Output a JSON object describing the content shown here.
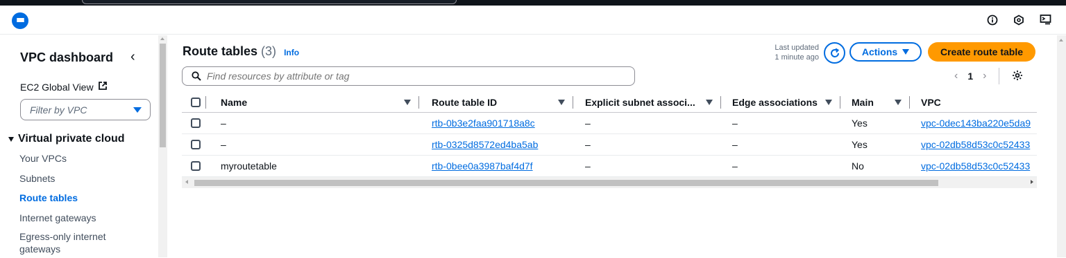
{
  "colors": {
    "accent": "#006ce0",
    "primary_button": "#ff9900",
    "top_strip": "#0f141a"
  },
  "header": {
    "icons": [
      "menu-icon",
      "info-icon",
      "notifications-icon",
      "cloudshell-icon"
    ]
  },
  "sidebar": {
    "title": "VPC dashboard",
    "ec2_global_view": "EC2 Global View",
    "filter_placeholder": "Filter by VPC",
    "section_title": "Virtual private cloud",
    "items": [
      {
        "label": "Your VPCs",
        "active": false
      },
      {
        "label": "Subnets",
        "active": false
      },
      {
        "label": "Route tables",
        "active": true
      },
      {
        "label": "Internet gateways",
        "active": false
      },
      {
        "label": "Egress-only internet gateways",
        "active": false
      }
    ]
  },
  "main": {
    "title": "Route tables",
    "count": "(3)",
    "info_link": "Info",
    "last_updated_label": "Last updated",
    "last_updated_value": "1 minute ago",
    "actions_label": "Actions",
    "create_label": "Create route table",
    "search_placeholder": "Find resources by attribute or tag",
    "page_number": "1",
    "table": {
      "columns": [
        "Name",
        "Route table ID",
        "Explicit subnet associ...",
        "Edge associations",
        "Main",
        "VPC"
      ],
      "rows": [
        {
          "name": "–",
          "route_table_id": "rtb-0b3e2faa901718a8c",
          "explicit_subnet": "–",
          "edge": "–",
          "main": "Yes",
          "vpc": "vpc-0dec143ba220e5da9"
        },
        {
          "name": "–",
          "route_table_id": "rtb-0325d8572ed4ba5ab",
          "explicit_subnet": "–",
          "edge": "–",
          "main": "Yes",
          "vpc": "vpc-02db58d53c0c52433"
        },
        {
          "name": "myroutetable",
          "route_table_id": "rtb-0bee0a3987baf4d7f",
          "explicit_subnet": "–",
          "edge": "–",
          "main": "No",
          "vpc": "vpc-02db58d53c0c52433"
        }
      ]
    }
  }
}
